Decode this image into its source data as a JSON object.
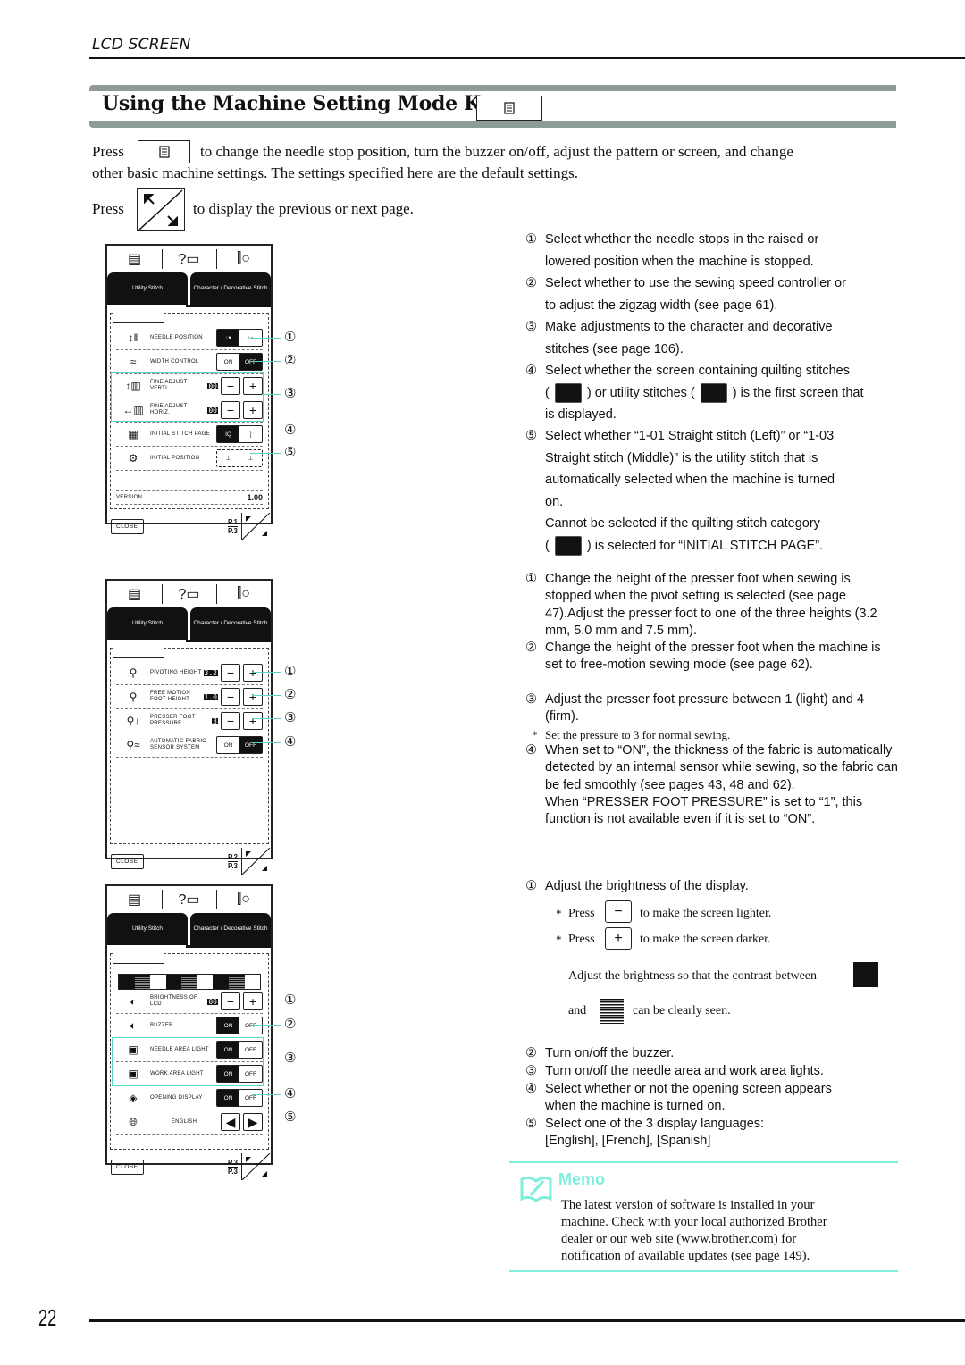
{
  "header": {
    "section_label": "LCD SCREEN",
    "title": "Using the Machine Setting Mode Key",
    "title_key_icon": "machine-setting-key-icon"
  },
  "intro": {
    "press_label": "Press",
    "line1_rest": "to change the needle stop position, turn the buzzer on/off, adjust the pattern or screen, and change",
    "line2": "other basic machine settings. The settings specified here are the default settings.",
    "press2_label": "Press",
    "line3_rest": "to display the previous or next page."
  },
  "lcd_common": {
    "top_icons": [
      "machine-setting-icon",
      "help-machine-icon",
      "needle-foot-icon"
    ],
    "tabs": [
      "Utility Stitch",
      "Character / Decorative Stitch"
    ],
    "close_label": "CLOSE",
    "minus": "−",
    "plus": "+",
    "on": "ON",
    "off": "OFF"
  },
  "screens": [
    {
      "page": "P.1",
      "total": "P.3",
      "rows": [
        {
          "label": "NEEDLE POSITION",
          "control": "needle-position-toggle",
          "selected": "down",
          "callout": "1"
        },
        {
          "label": "WIDTH CONTROL",
          "control": "on-off",
          "selected": "OFF",
          "callout": "2"
        },
        {
          "label": "FINE ADJUST VERTI.",
          "control": "stepper",
          "value": "00",
          "callout": "3"
        },
        {
          "label": "FINE ADJUST HORIZ.",
          "control": "stepper",
          "value": "00",
          "callout": "3"
        },
        {
          "label": "INITIAL STITCH PAGE",
          "control": "stitch-page-toggle",
          "selected": "quilting",
          "callout": "4"
        },
        {
          "label": "INITIAL POSITION",
          "control": "initial-position-toggle",
          "callout": "5"
        }
      ],
      "version_label": "VERSION",
      "version_value": "1.00"
    },
    {
      "page": "P.2",
      "total": "P.3",
      "rows": [
        {
          "label": "PIVOTING HEIGHT",
          "control": "stepper",
          "value": "3.2",
          "unit": "mm",
          "callout": "1"
        },
        {
          "label": "FREE MOTION FOOT HEIGHT",
          "control": "stepper",
          "value": "1.0",
          "unit": "mm",
          "callout": "2"
        },
        {
          "label": "PRESSER FOOT PRESSURE",
          "control": "stepper",
          "value": "3",
          "callout": "3"
        },
        {
          "label": "AUTOMATIC FABRIC SENSOR SYSTEM",
          "control": "on-off",
          "selected": "OFF",
          "callout": "4"
        }
      ]
    },
    {
      "page": "P.3",
      "total": "P.3",
      "rows": [
        {
          "label": "BRIGHTNESS OF LCD",
          "control": "stepper",
          "value": "00",
          "callout": "1"
        },
        {
          "label": "BUZZER",
          "control": "on-off",
          "selected": "ON",
          "callout": "2"
        },
        {
          "label": "NEEDLE AREA LIGHT",
          "control": "on-off",
          "selected": "ON",
          "callout": "3"
        },
        {
          "label": "WORK AREA LIGHT",
          "control": "on-off",
          "selected": "ON",
          "callout": "3"
        },
        {
          "label": "OPENING DISPLAY",
          "control": "on-off",
          "selected": "ON",
          "callout": "4"
        },
        {
          "label": "ENGLISH",
          "control": "language-selector",
          "callout": "5"
        }
      ]
    }
  ],
  "notes_p1": [
    {
      "num": "①",
      "lines": [
        "Select whether the needle stops in the raised or",
        "lowered position when the machine is stopped."
      ]
    },
    {
      "num": "②",
      "lines": [
        "Select whether to use the sewing speed controller or",
        "to adjust the zigzag width (see page 61)."
      ]
    },
    {
      "num": "③",
      "lines": [
        "Make adjustments to the character and decorative",
        "stitches (see page 106)."
      ]
    },
    {
      "num": "④",
      "lines": [
        "Select whether the screen containing quilting stitches",
        "( ",
        " ) or utility stitches ( ",
        " ) is the first screen that",
        "is displayed."
      ]
    },
    {
      "num": "⑤",
      "lines": [
        "Select whether “1-01 Straight stitch (Left)” or “1-03",
        "Straight stitch (Middle)” is the utility stitch that is",
        "automatically selected when the machine is turned",
        "on.",
        "Cannot be selected if the quilting stitch category",
        " ) is selected for “INITIAL STITCH PAGE”."
      ]
    }
  ],
  "notes_p2": [
    {
      "num": "①",
      "text": "Change the height of the presser foot when sewing is stopped when the pivot setting is selected (see page 47).Adjust the presser foot to one of the three heights (3.2 mm, 5.0 mm and 7.5 mm)."
    },
    {
      "num": "②",
      "text": "Change the height of the presser foot when the machine is set to free-motion sewing mode (see page 62)."
    },
    {
      "num": "③",
      "text": "Adjust the presser foot pressure between 1 (light) and 4 (firm)."
    },
    {
      "num": "*",
      "text": "Set the pressure to 3 for normal sewing."
    },
    {
      "num": "④",
      "text": "When set to “ON”, the thickness of the fabric is automatically detected by an internal sensor while sewing, so the fabric can be fed smoothly (see pages 43, 48 and 62).",
      "extra": "When “PRESSER FOOT PRESSURE” is set to “1”, this function is not available even if it is set to “ON”."
    }
  ],
  "notes_p3": {
    "n1": "Adjust the brightness of the display.",
    "press": "Press",
    "lighter": "to make the screen lighter.",
    "darker": "to make the screen darker.",
    "contrast1": "Adjust the brightness so that the contrast between",
    "and": "and",
    "contrast2": "can be clearly seen.",
    "n2": "Turn on/off the buzzer.",
    "n3": "Turn on/off the needle area and work area lights.",
    "n4a": "Select whether or not the opening screen appears",
    "n4b": "when the machine is turned on.",
    "n5a": "Select one of the 3 display languages:",
    "n5b": "[English], [French], [Spanish]"
  },
  "memo": {
    "title": "Memo",
    "lines": [
      "The latest version of software is installed in your",
      "machine. Check with your local authorized Brother",
      "dealer or our web site (www.brother.com) for",
      "notification of available updates (see page 149)."
    ]
  },
  "footer": {
    "page_number": "22"
  },
  "colors": {
    "accent_teal": "#7feedd",
    "callout_teal": "#5ad6c8",
    "title_bar": "#8e9c97"
  }
}
